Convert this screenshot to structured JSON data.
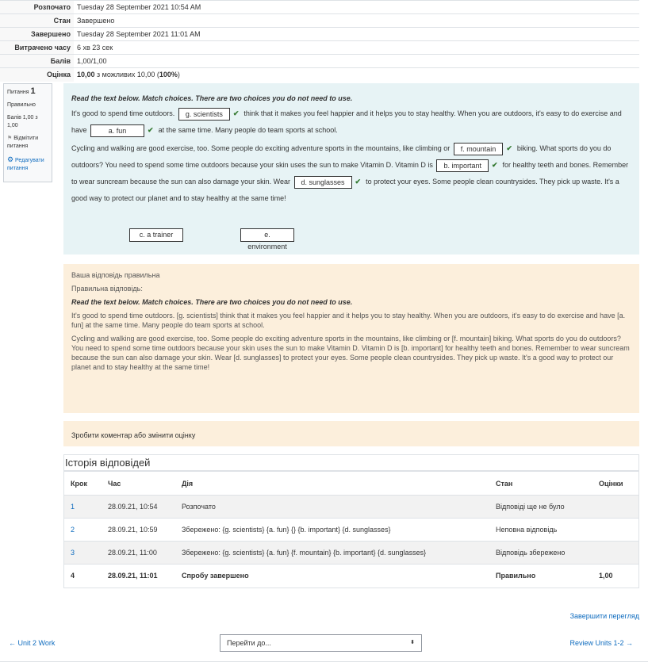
{
  "summary": [
    {
      "label": "Розпочато",
      "value": "Tuesday 28 September 2021 10:54 AM"
    },
    {
      "label": "Стан",
      "value": "Завершено"
    },
    {
      "label": "Завершено",
      "value": "Tuesday 28 September 2021 11:01 AM"
    },
    {
      "label": "Витрачено часу",
      "value": "6 хв 23 сек"
    },
    {
      "label": "Балів",
      "value": "1,00/1,00"
    },
    {
      "label": "Оцінка",
      "value_bold": "10,00",
      "value_mid": " з можливих 10,00 (",
      "value_pct": "100%",
      "value_end": ")"
    }
  ],
  "info": {
    "q_label": "Питання",
    "q_num": "1",
    "state": "Правильно",
    "marks": "Балів 1,00 з 1,00",
    "flag": "Відмітити питання",
    "edit": "Редагувати питання"
  },
  "question": {
    "instruction": "Read the text below. Match choices. There are two choices you do not need to use.",
    "p1a": "It's good to spend time outdoors.",
    "d1": "g. scientists",
    "p1b": "think that it makes you feel happier and it helps you to stay healthy. When you are outdoors, it's easy to do exercise and have",
    "d2": "a. fun",
    "p1c": "at the same time. Many people do team sports at school.",
    "p2a": "Cycling and walking are good exercise, too. Some people do exciting adventure sports in the mountains, like climbing or",
    "d3": "f. mountain",
    "p2b": "biking. What sports do you do outdoors? You need to spend some time outdoors because your skin uses the sun to make Vitamin D. Vitamin D is",
    "d4": "b. important",
    "p2c": "for healthy teeth and bones. Remember to wear suncream because the sun can also damage your skin. Wear",
    "d5": "d. sunglasses",
    "p2d": "to protect your eyes. Some people clean countrysides. They pick up waste. It's a good way to protect our planet and to stay healthy at the same time!",
    "unused": [
      "c. a trainer",
      "e. environment"
    ]
  },
  "feedback": {
    "correct": "Ваша відповідь правильна",
    "right_answer": "Правильна відповідь:",
    "instruction": "Read the text below. Match choices. There are two choices you do not need to use.",
    "p1": "It's good to spend time outdoors. [g. scientists] think that it makes you feel happier and it helps you to stay healthy. When you are outdoors, it's easy to do exercise and have [a. fun] at the same time. Many people do team sports at school.",
    "p2": "Cycling and walking are good exercise, too. Some people do exciting adventure sports in the mountains, like climbing or [f. mountain] biking. What sports do you do outdoors? You need to spend some time outdoors because your skin uses the sun to make Vitamin D. Vitamin D is [b. important] for healthy teeth and bones. Remember to wear suncream because the sun can also damage your skin. Wear [d. sunglasses] to protect your eyes. Some people clean countrysides. They pick up waste. It's a good way to protect our planet and to stay healthy at the same time!"
  },
  "comment": "Зробити коментар або змінити оцінку",
  "history": {
    "title": "Історія відповідей",
    "headers": [
      "Крок",
      "Час",
      "Дія",
      "Стан",
      "Оцінки"
    ],
    "rows": [
      [
        "1",
        "28.09.21, 10:54",
        "Розпочато",
        "Відповіді ще не було",
        ""
      ],
      [
        "2",
        "28.09.21, 10:59",
        "Збережено: {g. scientists} {a. fun} {} {b. important} {d. sunglasses}",
        "Неповна відповідь",
        ""
      ],
      [
        "3",
        "28.09.21, 11:00",
        "Збережено: {g. scientists} {a. fun} {f. mountain} {b. important} {d. sunglasses}",
        "Відповідь збережено",
        ""
      ],
      [
        "4",
        "28.09.21, 11:01",
        "Спробу завершено",
        "Правильно",
        "1,00"
      ]
    ]
  },
  "footer": {
    "finish": "Завершити перегляд",
    "prev": "← Unit 2 Work",
    "next": "Review Units 1-2 →",
    "jump": "Перейти до..."
  }
}
